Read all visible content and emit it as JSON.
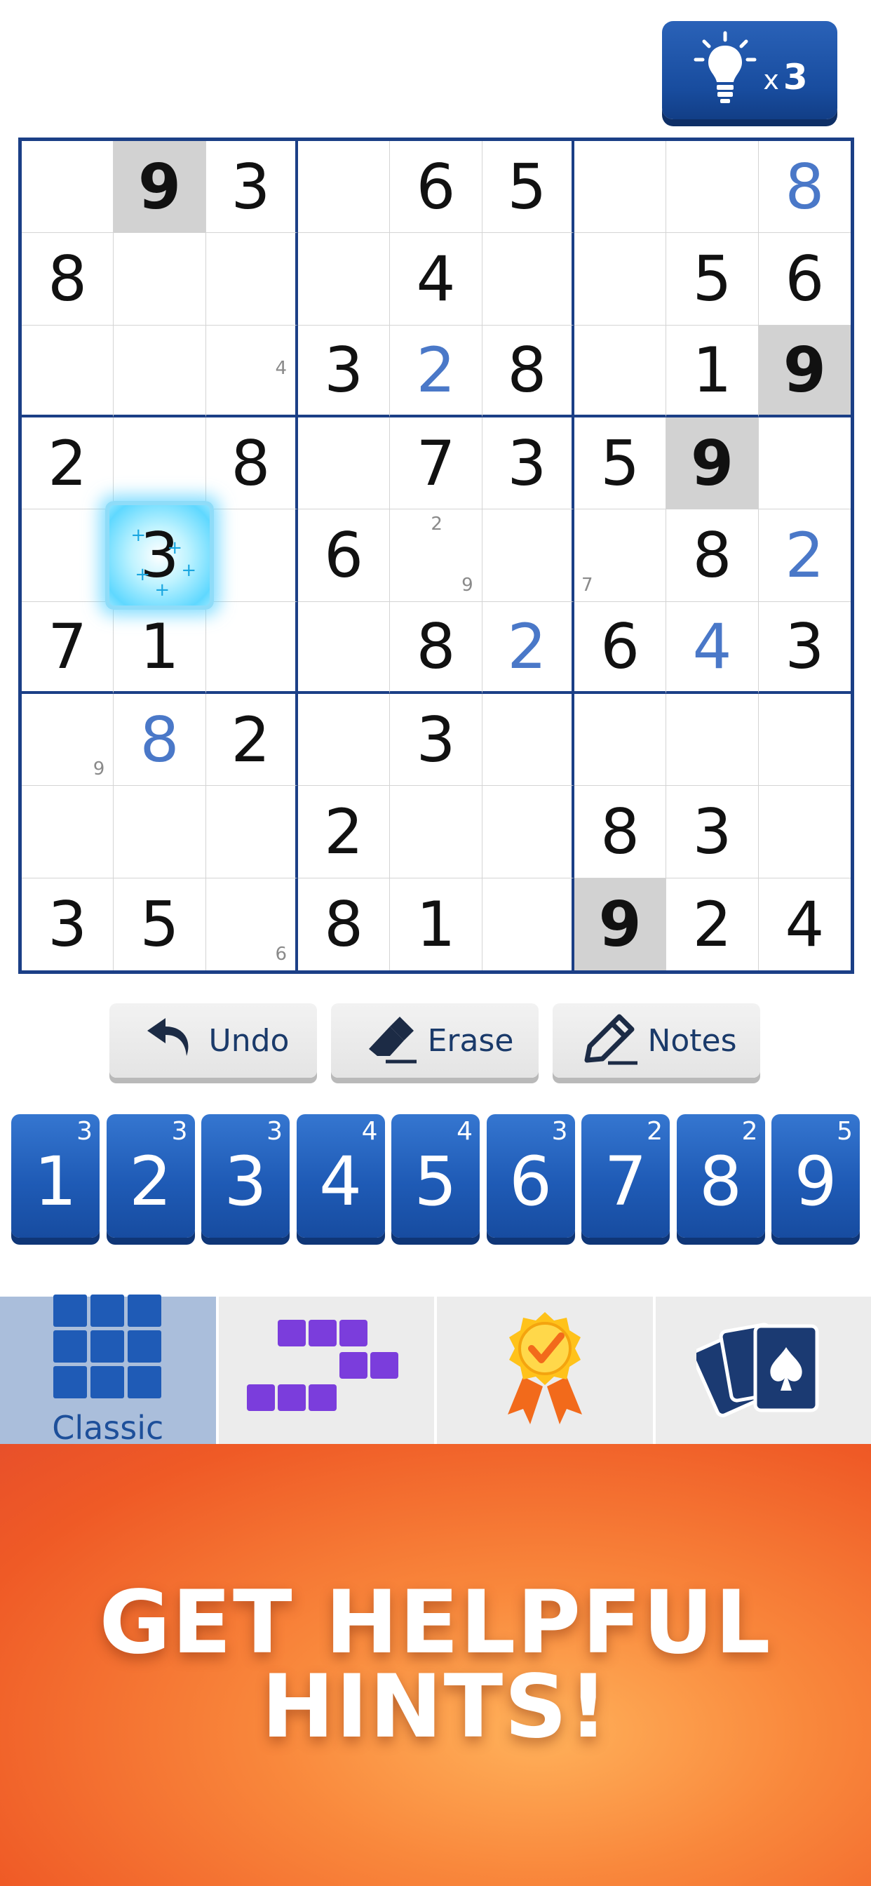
{
  "hint_button": {
    "icon": "lightbulb-icon",
    "prefix": "x",
    "count": "3"
  },
  "board": {
    "rows": [
      [
        {
          "v": ""
        },
        {
          "v": "9",
          "t": "g",
          "hl": true
        },
        {
          "v": "3",
          "t": "g"
        },
        {
          "v": ""
        },
        {
          "v": "6",
          "t": "g"
        },
        {
          "v": "5",
          "t": "g"
        },
        {
          "v": ""
        },
        {
          "v": ""
        },
        {
          "v": "8",
          "t": "u"
        }
      ],
      [
        {
          "v": "8",
          "t": "g"
        },
        {
          "v": ""
        },
        {
          "v": ""
        },
        {
          "v": ""
        },
        {
          "v": "4",
          "t": "g"
        },
        {
          "v": ""
        },
        {
          "v": ""
        },
        {
          "v": "5",
          "t": "g"
        },
        {
          "v": "6",
          "t": "g"
        }
      ],
      [
        {
          "v": ""
        },
        {
          "v": ""
        },
        {
          "v": "",
          "notes": [
            {
              "n": "4",
              "pos": "mr"
            }
          ]
        },
        {
          "v": "3",
          "t": "g"
        },
        {
          "v": "2",
          "t": "u"
        },
        {
          "v": "8",
          "t": "g"
        },
        {
          "v": ""
        },
        {
          "v": "1",
          "t": "g"
        },
        {
          "v": "9",
          "t": "g",
          "hl": true
        }
      ],
      [
        {
          "v": "2",
          "t": "g"
        },
        {
          "v": ""
        },
        {
          "v": "8",
          "t": "g"
        },
        {
          "v": ""
        },
        {
          "v": "7",
          "t": "g"
        },
        {
          "v": "3",
          "t": "g"
        },
        {
          "v": "5",
          "t": "g"
        },
        {
          "v": "9",
          "t": "g",
          "hl": true
        },
        {
          "v": ""
        }
      ],
      [
        {
          "v": ""
        },
        {
          "v": "3",
          "t": "g",
          "hint": true
        },
        {
          "v": ""
        },
        {
          "v": "6",
          "t": "g"
        },
        {
          "v": "",
          "notes": [
            {
              "n": "2",
              "pos": "tm"
            },
            {
              "n": "9",
              "pos": "br"
            }
          ]
        },
        {
          "v": ""
        },
        {
          "v": "",
          "notes": [
            {
              "n": "7",
              "pos": "bl"
            }
          ]
        },
        {
          "v": "8",
          "t": "g"
        },
        {
          "v": "2",
          "t": "u"
        }
      ],
      [
        {
          "v": "7",
          "t": "g"
        },
        {
          "v": "1",
          "t": "g"
        },
        {
          "v": ""
        },
        {
          "v": ""
        },
        {
          "v": "8",
          "t": "g"
        },
        {
          "v": "2",
          "t": "u"
        },
        {
          "v": "6",
          "t": "g"
        },
        {
          "v": "4",
          "t": "u"
        },
        {
          "v": "3",
          "t": "g"
        }
      ],
      [
        {
          "v": "",
          "notes": [
            {
              "n": "9",
              "pos": "br"
            }
          ]
        },
        {
          "v": "8",
          "t": "u"
        },
        {
          "v": "2",
          "t": "g"
        },
        {
          "v": ""
        },
        {
          "v": "3",
          "t": "g"
        },
        {
          "v": ""
        },
        {
          "v": ""
        },
        {
          "v": ""
        },
        {
          "v": ""
        }
      ],
      [
        {
          "v": ""
        },
        {
          "v": ""
        },
        {
          "v": ""
        },
        {
          "v": "2",
          "t": "g"
        },
        {
          "v": ""
        },
        {
          "v": ""
        },
        {
          "v": "8",
          "t": "g"
        },
        {
          "v": "3",
          "t": "g"
        },
        {
          "v": ""
        }
      ],
      [
        {
          "v": "3",
          "t": "g"
        },
        {
          "v": "5",
          "t": "g"
        },
        {
          "v": "",
          "notes": [
            {
              "n": "6",
              "pos": "br"
            }
          ]
        },
        {
          "v": "8",
          "t": "g"
        },
        {
          "v": "1",
          "t": "g"
        },
        {
          "v": ""
        },
        {
          "v": "9",
          "t": "g",
          "hl": true
        },
        {
          "v": "2",
          "t": "g"
        },
        {
          "v": "4",
          "t": "g"
        }
      ]
    ]
  },
  "tools": {
    "undo": {
      "label": "Undo",
      "icon": "undo-arrow-icon"
    },
    "erase": {
      "label": "Erase",
      "icon": "eraser-icon"
    },
    "notes": {
      "label": "Notes",
      "icon": "pencil-icon"
    }
  },
  "numpad": [
    {
      "n": "1",
      "remaining": "3"
    },
    {
      "n": "2",
      "remaining": "3"
    },
    {
      "n": "3",
      "remaining": "3"
    },
    {
      "n": "4",
      "remaining": "4"
    },
    {
      "n": "5",
      "remaining": "4"
    },
    {
      "n": "6",
      "remaining": "3"
    },
    {
      "n": "7",
      "remaining": "2"
    },
    {
      "n": "8",
      "remaining": "2"
    },
    {
      "n": "9",
      "remaining": "5"
    }
  ],
  "tabs": [
    {
      "label": "Classic",
      "icon": "classic-grid-icon",
      "active": true
    },
    {
      "label": "",
      "icon": "irregular-blocks-icon"
    },
    {
      "label": "",
      "icon": "award-ribbon-icon"
    },
    {
      "label": "",
      "icon": "playing-cards-icon"
    }
  ],
  "banner": {
    "line1": "GET HELPFUL",
    "line2": "HINTS!"
  },
  "colors": {
    "navy": "#1b3f86",
    "key_blue": "#1f5bb6",
    "user_digit": "#4a78c8",
    "banner_orange": "#ef5a26"
  }
}
